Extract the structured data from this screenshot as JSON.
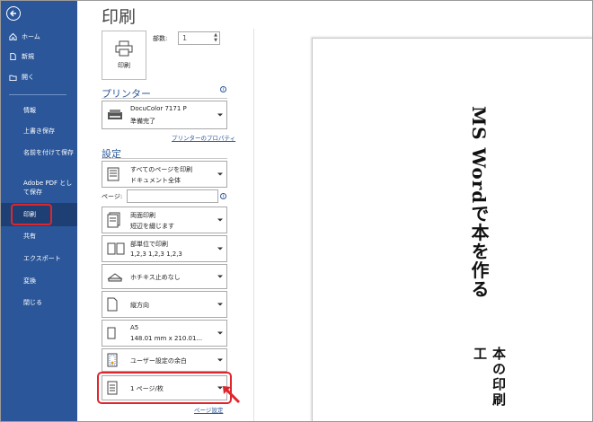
{
  "title": "印刷",
  "sidebar": {
    "items": [
      {
        "label": "ホーム",
        "icon": "home-icon"
      },
      {
        "label": "新規",
        "icon": "new-document-icon"
      },
      {
        "label": "開く",
        "icon": "open-folder-icon"
      }
    ],
    "sub_items": [
      "情報",
      "上書き保存",
      "名前を付けて保存",
      "Adobe PDF として保存",
      "印刷",
      "共有",
      "エクスポート",
      "変換",
      "閉じる"
    ],
    "active": "印刷"
  },
  "print": {
    "button_label": "印刷",
    "copies_label": "部数:",
    "copies_value": "1"
  },
  "printer": {
    "section_title": "プリンター",
    "name": "DocuColor 7171 P",
    "status": "準備完了",
    "properties_link": "プリンターのプロパティ"
  },
  "settings": {
    "section_title": "設定",
    "range": {
      "line1": "すべてのページを印刷",
      "line2": "ドキュメント全体"
    },
    "pages_label": "ページ:",
    "pages_value": "",
    "duplex": {
      "line1": "両面印刷",
      "line2": "短辺を綴じます"
    },
    "collate": {
      "line1": "部単位で印刷",
      "line2": "1,2,3    1,2,3    1,2,3"
    },
    "staple": {
      "line1": "ホチキス止めなし"
    },
    "orientation": {
      "line1": "縦方向"
    },
    "paper": {
      "line1": "A5",
      "line2": "148.01 mm x 210.01..."
    },
    "margins": {
      "line1": "ユーザー設定の余白"
    },
    "pages_per_sheet": {
      "line1": "1 ページ/枚"
    },
    "page_setup_link": "ページ設定"
  },
  "preview": {
    "title_vertical": "MS Wordで本を作る",
    "subtitle_vertical": "本の印刷工"
  },
  "colors": {
    "sidebar": "#2b579a",
    "accent": "#2b579a",
    "highlight": "#e0262d"
  }
}
